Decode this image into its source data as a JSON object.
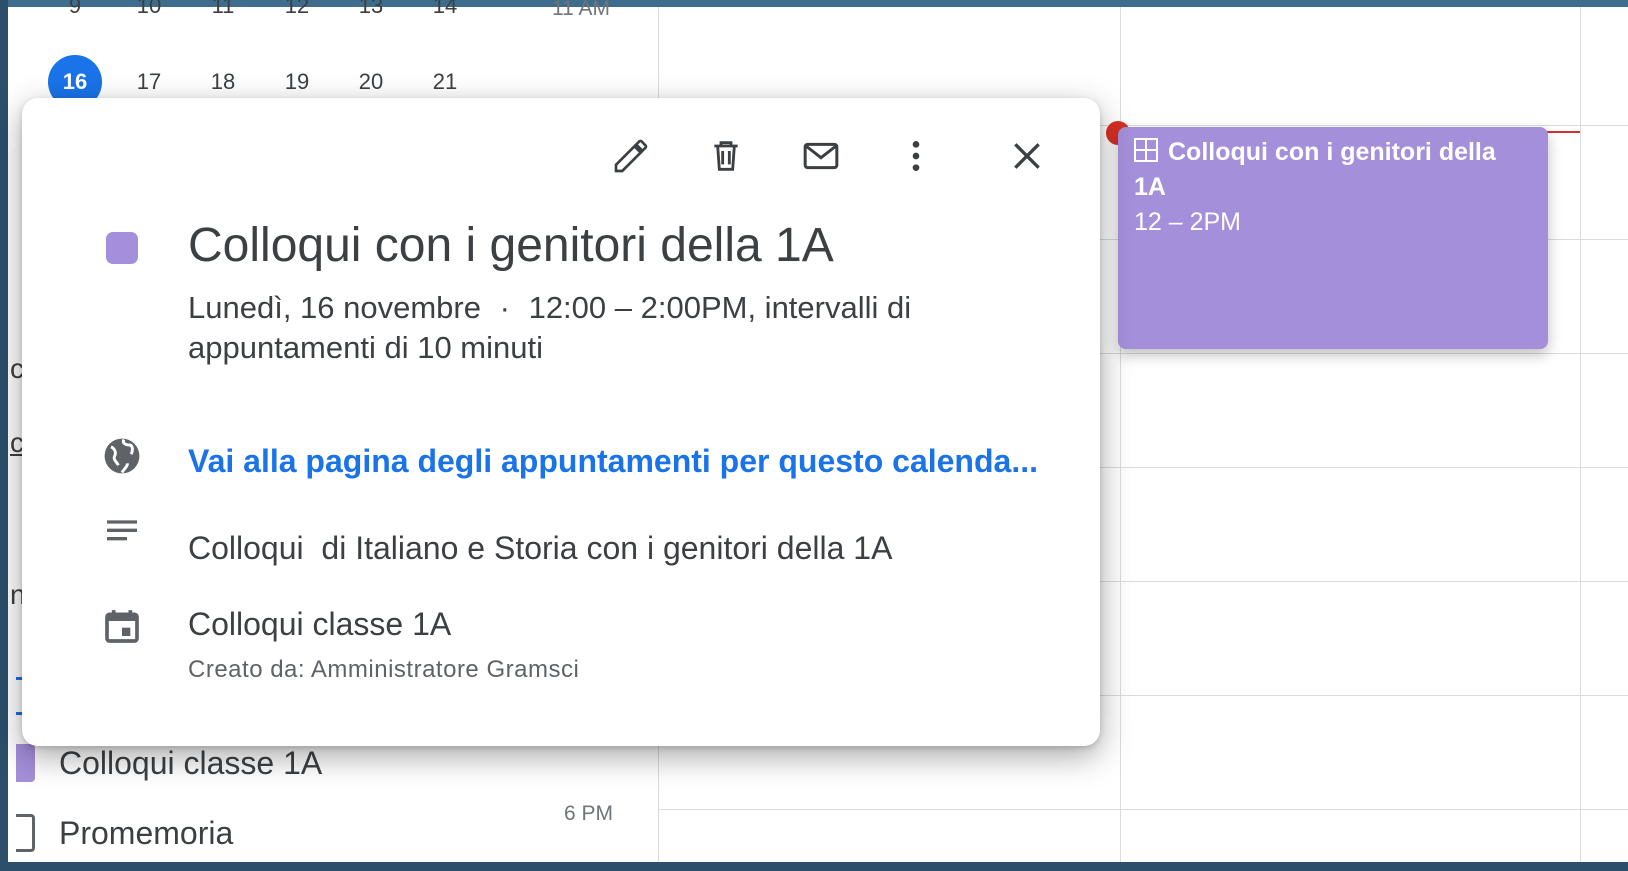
{
  "mini_calendar": {
    "row_partial": [
      "9",
      "10",
      "11",
      "12",
      "13",
      "14"
    ],
    "row_week": [
      "16",
      "17",
      "18",
      "19",
      "20",
      "21"
    ],
    "today": "16"
  },
  "sidebar": {
    "frag_1": "c",
    "frag_2": "c",
    "frag_3": "n",
    "calendars": [
      {
        "label": "Colloqui classe 1A",
        "color": "#a48fda"
      },
      {
        "label": "Promemoria",
        "color": "#1a73e8"
      }
    ]
  },
  "time_labels": {
    "top": "11 AM",
    "bottom": "6 PM"
  },
  "event_chip": {
    "title": "Colloqui con i genitori della 1A",
    "time": "12 – 2PM",
    "color": "#a48fda"
  },
  "popup": {
    "title": "Colloqui con i genitori della 1A",
    "date": "Lunedì, 16 novembre",
    "separator": "·",
    "time_text": "12:00 – 2:00PM, intervalli di appuntamenti di 10 minuti",
    "link_text": "Vai alla pagina degli appuntamenti per questo calenda...",
    "description": "Colloqui  di Italiano e Storia con i genitori della 1A",
    "calendar_name": "Colloqui classe 1A",
    "creator": "Creato da: Amministratore Gramsci",
    "toolbar_icons": [
      "edit-icon",
      "delete-icon",
      "email-icon",
      "more-icon",
      "close-icon"
    ]
  },
  "colors": {
    "accent": "#1a73e8",
    "event": "#a48fda",
    "now_line": "#d93025"
  }
}
